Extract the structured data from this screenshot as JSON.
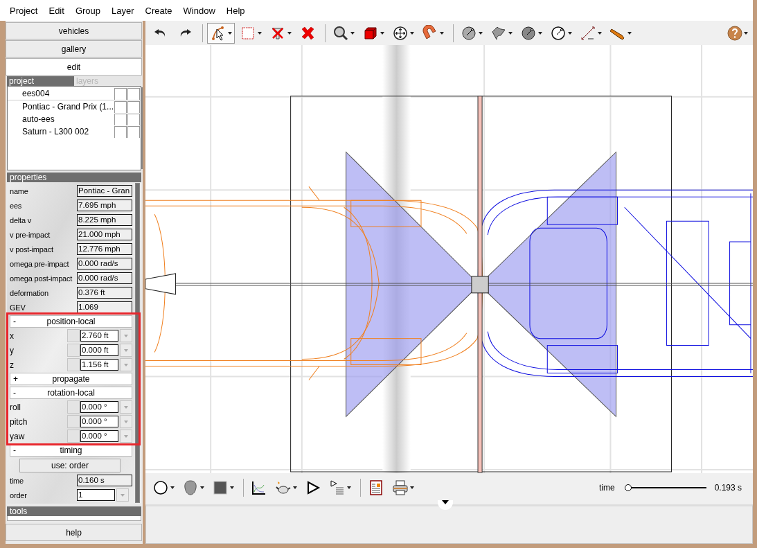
{
  "menu": [
    "Project",
    "Edit",
    "Group",
    "Layer",
    "Create",
    "Window",
    "Help"
  ],
  "nav": [
    {
      "label": "vehicles",
      "selected": false
    },
    {
      "label": "gallery",
      "selected": false
    },
    {
      "label": "edit",
      "selected": true
    }
  ],
  "project_panel": {
    "tabs": [
      {
        "label": "project",
        "selected": true
      },
      {
        "label": "layers",
        "selected": false
      }
    ],
    "items": [
      {
        "name": "ees004",
        "checks": [
          false,
          false
        ]
      },
      {
        "name": "Pontiac - Grand Prix (1...",
        "checks": [
          false,
          false
        ]
      },
      {
        "name": "auto-ees",
        "checks": [
          false,
          false
        ]
      },
      {
        "name": "Saturn - L300 002",
        "checks": [
          false,
          false
        ]
      }
    ]
  },
  "properties": {
    "title": "properties",
    "sections": [
      {
        "kind": "plain",
        "rows": [
          {
            "label": "name",
            "value": "Pontiac - Gran",
            "kind": "readonly"
          },
          {
            "label": "ees",
            "value": "7.695 mph",
            "kind": "readonly"
          },
          {
            "label": "delta v",
            "value": "8.225 mph",
            "kind": "readonly"
          },
          {
            "label": "v pre-impact",
            "value": "21.000 mph",
            "kind": "readonly"
          },
          {
            "label": "v post-impact",
            "value": "12.776 mph",
            "kind": "readonly"
          },
          {
            "label": "omega pre-impact",
            "value": "0.000 rad/s",
            "kind": "readonly"
          },
          {
            "label": "omega post-impact",
            "value": "0.000 rad/s",
            "kind": "readonly"
          },
          {
            "label": "deformation",
            "value": "0.376 ft",
            "kind": "readonly"
          },
          {
            "label": "GEV",
            "value": "1.069",
            "kind": "readonly"
          }
        ]
      },
      {
        "kind": "group",
        "marker": "-",
        "title": "position-local",
        "rows": [
          {
            "label": "x",
            "value": "2.760 ft",
            "kind": "unit"
          },
          {
            "label": "y",
            "value": "0.000 ft",
            "kind": "unit"
          },
          {
            "label": "z",
            "value": "1.156 ft",
            "kind": "unit"
          }
        ]
      },
      {
        "kind": "group",
        "marker": "+",
        "title": "propagate"
      },
      {
        "kind": "group",
        "marker": "-",
        "title": "rotation-local",
        "rows": [
          {
            "label": "roll",
            "value": "0.000 °",
            "kind": "unit"
          },
          {
            "label": "pitch",
            "value": "0.000 °",
            "kind": "unit"
          },
          {
            "label": "yaw",
            "value": "0.000 °",
            "kind": "unit"
          }
        ]
      },
      {
        "kind": "group",
        "marker": "-",
        "title": "timing",
        "button": "use: order",
        "rows": [
          {
            "label": "time",
            "value": "0.160 s",
            "kind": "readonly"
          },
          {
            "label": "order",
            "value": "1",
            "kind": "choice"
          }
        ]
      }
    ]
  },
  "tools": {
    "title": "tools"
  },
  "help": "help",
  "toolbar": [
    [
      {
        "kind": "undo",
        "dropdown": false,
        "selected": false
      },
      {
        "kind": "redo",
        "dropdown": false,
        "selected": false
      }
    ],
    [
      {
        "kind": "select",
        "dropdown": true,
        "selected": true
      },
      {
        "kind": "marquee",
        "dropdown": true,
        "selected": false
      },
      {
        "kind": "filter-delete",
        "dropdown": true,
        "selected": false
      },
      {
        "kind": "delete",
        "dropdown": false,
        "selected": false
      }
    ],
    [
      {
        "kind": "zoom",
        "dropdown": true,
        "selected": false
      },
      {
        "kind": "cube",
        "dropdown": true,
        "selected": false
      },
      {
        "kind": "move",
        "dropdown": true,
        "selected": false
      },
      {
        "kind": "magnet",
        "dropdown": true,
        "selected": false
      }
    ],
    [
      {
        "kind": "sphere",
        "dropdown": true,
        "selected": false
      },
      {
        "kind": "surface",
        "dropdown": true,
        "selected": false
      },
      {
        "kind": "disk",
        "dropdown": true,
        "selected": false
      },
      {
        "kind": "circle",
        "dropdown": true,
        "selected": false
      },
      {
        "kind": "measure",
        "dropdown": true,
        "selected": false
      },
      {
        "kind": "pipe",
        "dropdown": true,
        "selected": false
      }
    ]
  ],
  "bottom_toolbar": [
    [
      {
        "kind": "ring",
        "dropdown": true,
        "selected": false
      },
      {
        "kind": "blob",
        "dropdown": true,
        "selected": false
      },
      {
        "kind": "square",
        "dropdown": true,
        "selected": false
      }
    ],
    [
      {
        "kind": "graph",
        "dropdown": false,
        "selected": false
      },
      {
        "kind": "teapot",
        "dropdown": true,
        "selected": false
      },
      {
        "kind": "play",
        "dropdown": false,
        "selected": false
      },
      {
        "kind": "play-list",
        "dropdown": true,
        "selected": false
      }
    ],
    [
      {
        "kind": "report",
        "dropdown": false,
        "selected": false
      },
      {
        "kind": "printer",
        "dropdown": true,
        "selected": false
      }
    ]
  ],
  "time_slider": {
    "label": "time",
    "level": 0,
    "reading": "0.193 s"
  }
}
